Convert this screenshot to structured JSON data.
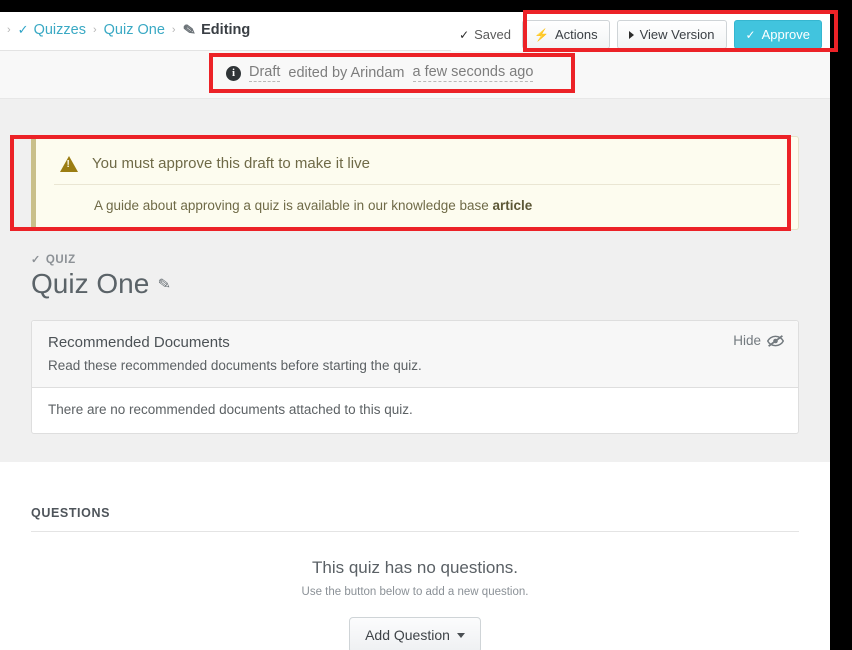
{
  "breadcrumb": {
    "leading_separator": "›",
    "items": [
      {
        "label": "Quizzes",
        "icon": "check-icon",
        "type": "link"
      },
      {
        "label": "Quiz One",
        "icon": "",
        "type": "link"
      },
      {
        "label": "Editing",
        "icon": "pencil-icon",
        "type": "current"
      }
    ],
    "separator": "›"
  },
  "toolbar": {
    "saved_label": "Saved",
    "saved_icon": "check-icon",
    "actions_label": "Actions",
    "actions_icon": "bolt-icon",
    "view_version_label": "View Version",
    "view_version_icon": "caret-right-icon",
    "approve_label": "Approve",
    "approve_icon": "check-icon",
    "approve_color": "#41c4de"
  },
  "draft_notice": {
    "icon": "info-icon",
    "icon_glyph": "i",
    "status": "Draft",
    "middle": " edited by Arindam ",
    "timestamp": "a few seconds ago"
  },
  "alert": {
    "icon": "warning-triangle-icon",
    "title": "You must approve this draft to make it live",
    "body_prefix": "A guide about approving a quiz is available in our knowledge base ",
    "body_link": "article",
    "background": "#fdfcef",
    "accent": "#c9bf8a"
  },
  "quiz": {
    "kicker_icon": "check-icon",
    "kicker": "QUIZ",
    "title": "Quiz One",
    "edit_icon": "pencil-icon"
  },
  "recommended_documents": {
    "title": "Recommended Documents",
    "subtitle": "Read these recommended documents before starting the quiz.",
    "hide_label": "Hide",
    "hide_icon": "eye-slash-icon",
    "empty_message": "There are no recommended documents attached to this quiz."
  },
  "questions": {
    "section_title": "QUESTIONS",
    "empty_title": "This quiz has no questions.",
    "empty_subtitle": "Use the button below to add a new question.",
    "add_button_label": "Add Question",
    "add_button_caret": "caret-down-icon"
  },
  "annotations": {
    "color": "#ec2227",
    "boxes": [
      {
        "name": "toolbar-highlight"
      },
      {
        "name": "draft-notice-highlight"
      },
      {
        "name": "alert-highlight"
      }
    ]
  }
}
